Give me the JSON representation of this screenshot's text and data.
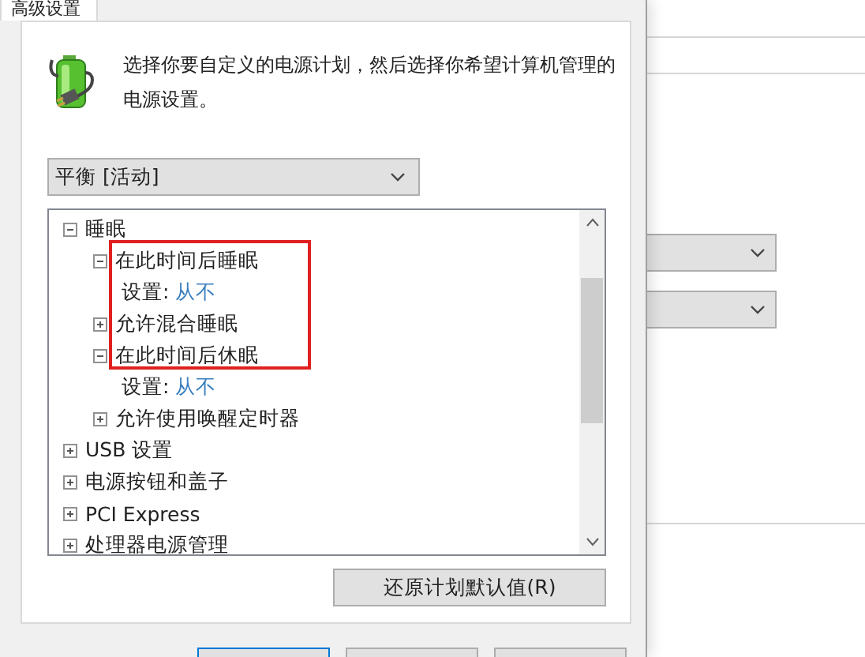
{
  "dialog": {
    "tab": {
      "label": "高级设置",
      "selected": true
    },
    "description": "选择你要自定义的电源计划，然后选择你希望计算机管理的电源设置。",
    "plan_dropdown": {
      "value": "平衡 [活动]"
    },
    "settings_tree": [
      {
        "label": "睡眠",
        "expanded": true,
        "children": [
          {
            "label": "在此时间后睡眠",
            "expanded": true,
            "children": [
              {
                "kind": "setting",
                "label": "设置:",
                "value": "从不"
              }
            ]
          },
          {
            "label": "允许混合睡眠",
            "expanded": false
          },
          {
            "label": "在此时间后休眠",
            "expanded": true,
            "children": [
              {
                "kind": "setting",
                "label": "设置:",
                "value": "从不"
              }
            ]
          },
          {
            "label": "允许使用唤醒定时器",
            "expanded": false
          }
        ]
      },
      {
        "label": "USB 设置",
        "expanded": false
      },
      {
        "label": "电源按钮和盖子",
        "expanded": false
      },
      {
        "label": "PCI Express",
        "expanded": false
      },
      {
        "label": "处理器电源管理",
        "expanded": false
      }
    ],
    "restore_button": "还原计划默认值(R)",
    "footer_buttons": [
      {
        "default": true
      },
      {
        "default": false
      },
      {
        "default": false
      }
    ]
  },
  "background_window": {
    "dropdowns": [
      {
        "kind": "dropdown"
      },
      {
        "kind": "dropdown"
      }
    ]
  }
}
